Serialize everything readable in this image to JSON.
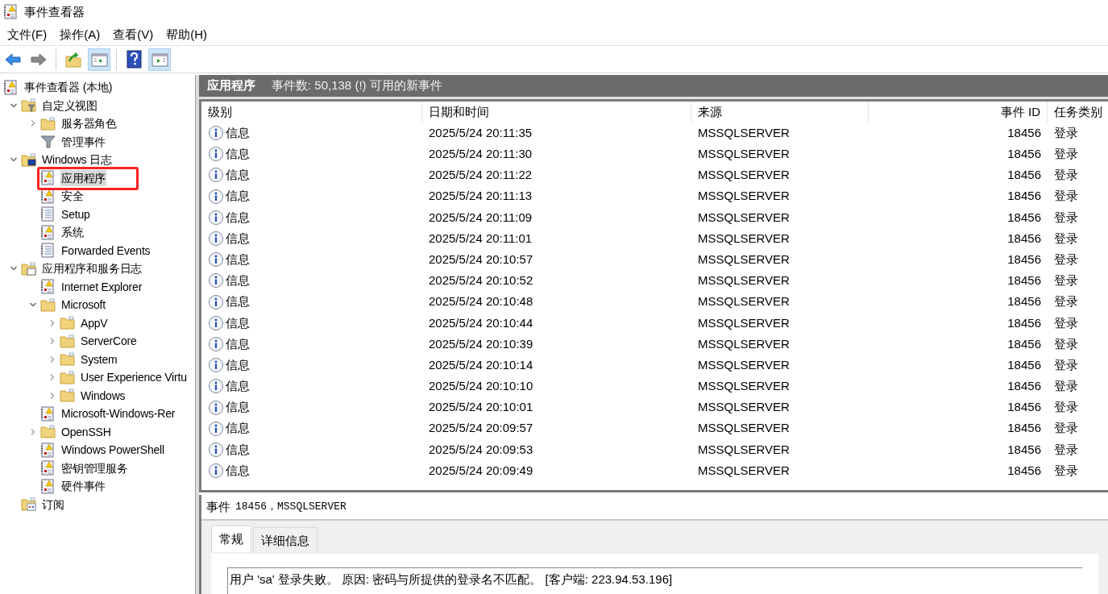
{
  "window": {
    "title": "事件查看器"
  },
  "menu": [
    "文件(F)",
    "操作(A)",
    "查看(V)",
    "帮助(H)"
  ],
  "toolbar": [
    {
      "kind": "back"
    },
    {
      "kind": "forward"
    },
    {
      "kind": "sep"
    },
    {
      "kind": "up"
    },
    {
      "kind": "hide-tree",
      "selected": true
    },
    {
      "kind": "sep"
    },
    {
      "kind": "help"
    },
    {
      "kind": "show-actions",
      "selected": true
    }
  ],
  "tree": [
    {
      "label": "事件查看器 (本地)",
      "kind": "root",
      "children": [
        {
          "label": "自定义视图",
          "kind": "custom",
          "expanded": true,
          "children": [
            {
              "label": "服务器角色",
              "kind": "folder",
              "expanded": false
            },
            {
              "label": "管理事件",
              "kind": "filter"
            }
          ]
        },
        {
          "label": "Windows 日志",
          "kind": "winlogs",
          "expanded": true,
          "children": [
            {
              "label": "应用程序",
              "kind": "log",
              "selected": true,
              "highlighted": true
            },
            {
              "label": "安全",
              "kind": "log",
              "selected": false
            },
            {
              "label": "Setup",
              "kind": "plainlog",
              "selected": false
            },
            {
              "label": "系统",
              "kind": "log",
              "selected": false
            },
            {
              "label": "Forwarded Events",
              "kind": "plainlog",
              "selected": false
            }
          ]
        },
        {
          "label": "应用程序和服务日志",
          "kind": "appfolder",
          "expanded": true,
          "children": [
            {
              "label": "Internet Explorer",
              "kind": "log",
              "selected": false
            },
            {
              "label": "Microsoft",
              "kind": "folder",
              "expanded": true,
              "children": [
                {
                  "label": "AppV",
                  "kind": "folder",
                  "expanded": false
                },
                {
                  "label": "ServerCore",
                  "kind": "folder",
                  "expanded": false
                },
                {
                  "label": "System",
                  "kind": "folder",
                  "expanded": false
                },
                {
                  "label": "User Experience Virtu",
                  "kind": "folder",
                  "expanded": false
                },
                {
                  "label": "Windows",
                  "kind": "folder",
                  "expanded": false
                }
              ]
            },
            {
              "label": "Microsoft-Windows-Rer",
              "kind": "log",
              "selected": false
            },
            {
              "label": "OpenSSH",
              "kind": "folder",
              "expanded": false
            },
            {
              "label": "Windows PowerShell",
              "kind": "log",
              "selected": false
            },
            {
              "label": "密钥管理服务",
              "kind": "log",
              "selected": false
            },
            {
              "label": "硬件事件",
              "kind": "log",
              "selected": false
            }
          ]
        },
        {
          "label": "订阅",
          "kind": "subscriptions"
        }
      ]
    }
  ],
  "list_header": {
    "title": "应用程序",
    "summary": "事件数: 50,138 (!) 可用的新事件"
  },
  "table": {
    "columns": [
      "级别",
      "日期和时间",
      "来源",
      "事件 ID",
      "任务类别"
    ],
    "rows": [
      {
        "kind": "info",
        "level": "信息",
        "time": "2025/5/24 20:11:35",
        "source": "MSSQLSERVER",
        "id": "18456",
        "task": "登录"
      },
      {
        "kind": "info",
        "level": "信息",
        "time": "2025/5/24 20:11:30",
        "source": "MSSQLSERVER",
        "id": "18456",
        "task": "登录"
      },
      {
        "kind": "info",
        "level": "信息",
        "time": "2025/5/24 20:11:22",
        "source": "MSSQLSERVER",
        "id": "18456",
        "task": "登录"
      },
      {
        "kind": "info",
        "level": "信息",
        "time": "2025/5/24 20:11:13",
        "source": "MSSQLSERVER",
        "id": "18456",
        "task": "登录"
      },
      {
        "kind": "info",
        "level": "信息",
        "time": "2025/5/24 20:11:09",
        "source": "MSSQLSERVER",
        "id": "18456",
        "task": "登录"
      },
      {
        "kind": "info",
        "level": "信息",
        "time": "2025/5/24 20:11:01",
        "source": "MSSQLSERVER",
        "id": "18456",
        "task": "登录"
      },
      {
        "kind": "info",
        "level": "信息",
        "time": "2025/5/24 20:10:57",
        "source": "MSSQLSERVER",
        "id": "18456",
        "task": "登录"
      },
      {
        "kind": "info",
        "level": "信息",
        "time": "2025/5/24 20:10:52",
        "source": "MSSQLSERVER",
        "id": "18456",
        "task": "登录"
      },
      {
        "kind": "info",
        "level": "信息",
        "time": "2025/5/24 20:10:48",
        "source": "MSSQLSERVER",
        "id": "18456",
        "task": "登录"
      },
      {
        "kind": "info",
        "level": "信息",
        "time": "2025/5/24 20:10:44",
        "source": "MSSQLSERVER",
        "id": "18456",
        "task": "登录"
      },
      {
        "kind": "info",
        "level": "信息",
        "time": "2025/5/24 20:10:39",
        "source": "MSSQLSERVER",
        "id": "18456",
        "task": "登录"
      },
      {
        "kind": "info",
        "level": "信息",
        "time": "2025/5/24 20:10:14",
        "source": "MSSQLSERVER",
        "id": "18456",
        "task": "登录"
      },
      {
        "kind": "info",
        "level": "信息",
        "time": "2025/5/24 20:10:10",
        "source": "MSSQLSERVER",
        "id": "18456",
        "task": "登录"
      },
      {
        "kind": "info",
        "level": "信息",
        "time": "2025/5/24 20:10:01",
        "source": "MSSQLSERVER",
        "id": "18456",
        "task": "登录"
      },
      {
        "kind": "info",
        "level": "信息",
        "time": "2025/5/24 20:09:57",
        "source": "MSSQLSERVER",
        "id": "18456",
        "task": "登录"
      },
      {
        "kind": "info",
        "level": "信息",
        "time": "2025/5/24 20:09:53",
        "source": "MSSQLSERVER",
        "id": "18456",
        "task": "登录"
      },
      {
        "kind": "info",
        "level": "信息",
        "time": "2025/5/24 20:09:49",
        "source": "MSSQLSERVER",
        "id": "18456",
        "task": "登录"
      }
    ]
  },
  "detail": {
    "title": "事件",
    "subtitle": "18456，MSSQLSERVER",
    "tabs": [
      {
        "label": "常规",
        "selected": true
      },
      {
        "label": "详细信息",
        "selected": false
      }
    ],
    "message": "用户 'sa' 登录失败。 原因: 密码与所提供的登录名不匹配。 [客户端: 223.94.53.196]"
  }
}
